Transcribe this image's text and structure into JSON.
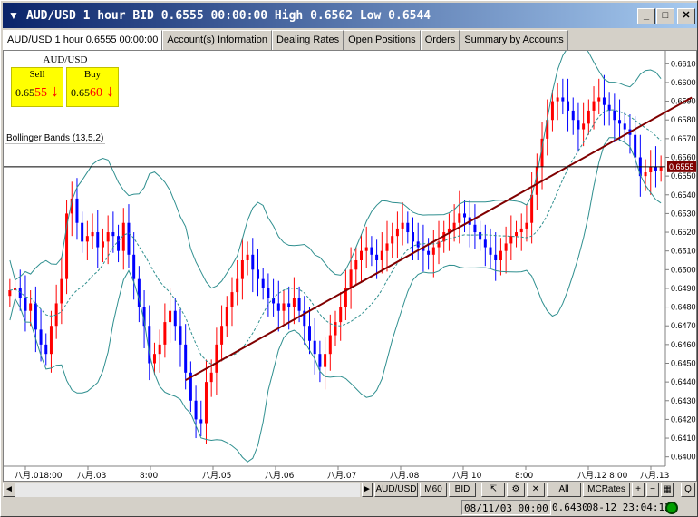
{
  "window": {
    "title": "AUD/USD 1 hour BID 0.6555 00:00:00 High 0.6562 Low 0.6544",
    "logo_glyph": "▼",
    "minimize_glyph": "_",
    "maximize_glyph": "□",
    "close_glyph": "✕"
  },
  "tabs": [
    {
      "label": "AUD/USD 1 hour 0.6555 00:00:00"
    },
    {
      "label": "Account(s) Information"
    },
    {
      "label": "Dealing Rates"
    },
    {
      "label": "Open Positions"
    },
    {
      "label": "Orders"
    },
    {
      "label": "Summary by Accounts"
    }
  ],
  "quote": {
    "symbol": "AUD/USD",
    "sell_label": "Sell",
    "sell_prefix": "0.65",
    "sell_big": "55",
    "buy_label": "Buy",
    "buy_prefix": "0.65",
    "buy_big": "60",
    "arrow_glyph": "↓"
  },
  "indicator": {
    "label": "Bollinger Bands (13,5,2)"
  },
  "price_axis": {
    "labels": [
      "0.6610",
      "0.6600",
      "0.6590",
      "0.6580",
      "0.6570",
      "0.6560",
      "0.6550",
      "0.6540",
      "0.6530",
      "0.6520",
      "0.6510",
      "0.6500",
      "0.6490",
      "0.6480",
      "0.6470",
      "0.6460",
      "0.6450",
      "0.6440",
      "0.6430",
      "0.6420",
      "0.6410",
      "0.6400"
    ],
    "current_price": "0.6555"
  },
  "time_axis": {
    "labels": [
      "八月.018:00",
      "八月.03",
      "8:00",
      "八月.05",
      "八月.06",
      "八月.07",
      "八月.08",
      "八月.10",
      "8:00",
      "八月.12 8:00",
      "八月.13"
    ]
  },
  "scrollbar": {
    "left_glyph": "◄",
    "play_glyph": "►",
    "symbol_button": "AUD/USD",
    "period_button": "M60",
    "side_button": "BID",
    "all_button": "All",
    "source_button": "MCRates",
    "q_button": "Q"
  },
  "status": {
    "time": "08/11/03 00:00",
    "price": "0.6430",
    "clock": "08-12 23:04:12"
  },
  "colors": {
    "up_candle": "#ff0000",
    "down_candle": "#0000ff",
    "band": "#2f8f8f",
    "trendline": "#800000",
    "current_price_line": "#000000",
    "current_price_tag": "#800000"
  },
  "chart_data": {
    "type": "candlestick",
    "y_range": [
      0.6395,
      0.6615
    ],
    "current_price": 0.6555,
    "closes": [
      0.6489,
      0.649,
      0.6485,
      0.6478,
      0.6482,
      0.6468,
      0.646,
      0.6455,
      0.647,
      0.6482,
      0.6495,
      0.653,
      0.6538,
      0.6525,
      0.6515,
      0.6518,
      0.652,
      0.6512,
      0.6515,
      0.652,
      0.6518,
      0.651,
      0.6525,
      0.6508,
      0.6495,
      0.648,
      0.647,
      0.645,
      0.6455,
      0.646,
      0.6472,
      0.6478,
      0.647,
      0.646,
      0.6445,
      0.643,
      0.642,
      0.6418,
      0.644,
      0.6445,
      0.646,
      0.647,
      0.648,
      0.6488,
      0.6495,
      0.6505,
      0.6508,
      0.65,
      0.6495,
      0.649,
      0.6485,
      0.6482,
      0.6478,
      0.6482,
      0.648,
      0.6485,
      0.6478,
      0.647,
      0.6462,
      0.6455,
      0.6448,
      0.6455,
      0.6465,
      0.6472,
      0.648,
      0.649,
      0.65,
      0.6505,
      0.651,
      0.6512,
      0.6508,
      0.6505,
      0.651,
      0.6514,
      0.6518,
      0.6522,
      0.6525,
      0.652,
      0.6515,
      0.6512,
      0.651,
      0.6508,
      0.6512,
      0.6515,
      0.652,
      0.6522,
      0.6525,
      0.653,
      0.6528,
      0.6524,
      0.652,
      0.6516,
      0.6512,
      0.6508,
      0.6505,
      0.651,
      0.6514,
      0.6518,
      0.652,
      0.6522,
      0.6525,
      0.654,
      0.6555,
      0.657,
      0.658,
      0.659,
      0.6592,
      0.659,
      0.6585,
      0.658,
      0.6575,
      0.6578,
      0.6585,
      0.659,
      0.6592,
      0.6588,
      0.6585,
      0.658,
      0.6578,
      0.6575,
      0.6572,
      0.656,
      0.655,
      0.6552,
      0.6555,
      0.6553,
      0.6555
    ],
    "bollinger": {
      "period": 13,
      "shift": 5,
      "deviation": 2
    }
  }
}
